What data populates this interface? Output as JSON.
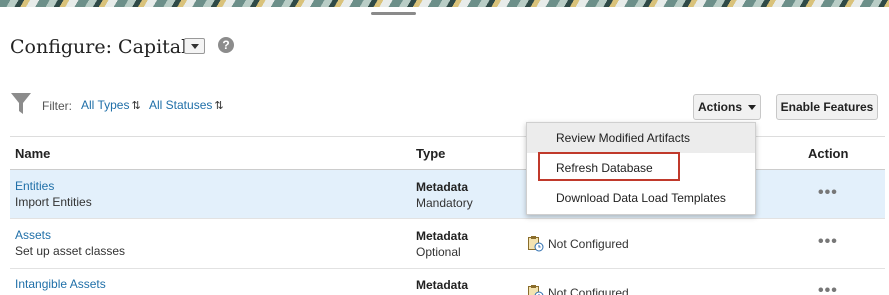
{
  "header": {
    "title": "Configure: Capital",
    "help_icon": "?"
  },
  "filter": {
    "label": "Filter:",
    "types": "All Types",
    "statuses": "All Statuses",
    "sort_glyph": "⇅"
  },
  "toolbar": {
    "actions_label": "Actions",
    "enable_features_label": "Enable Features"
  },
  "table": {
    "columns": [
      "Name",
      "Type",
      "Action"
    ],
    "rows": [
      {
        "name": "Entities",
        "description": "Import Entities",
        "type": "Metadata",
        "requirement": "Mandatory",
        "status": "",
        "action": "•••"
      },
      {
        "name": "Assets",
        "description": "Set up asset classes",
        "type": "Metadata",
        "requirement": "Optional",
        "status": "Not Configured",
        "action": "•••"
      },
      {
        "name": "Intangible Assets",
        "description": "",
        "type": "Metadata",
        "requirement": "",
        "status": "Not Configured",
        "action": "•••"
      }
    ]
  },
  "actions_menu": {
    "items": [
      "Review Modified Artifacts",
      "Refresh Database",
      "Download Data Load Templates"
    ]
  },
  "colors": {
    "link": "#1f6fa8",
    "selected_row": "#e3f0fb",
    "highlight_box": "#c0392b"
  },
  "icons": {
    "filter": "funnel-icon",
    "status": "clipboard-clock-icon",
    "help": "help-icon"
  }
}
